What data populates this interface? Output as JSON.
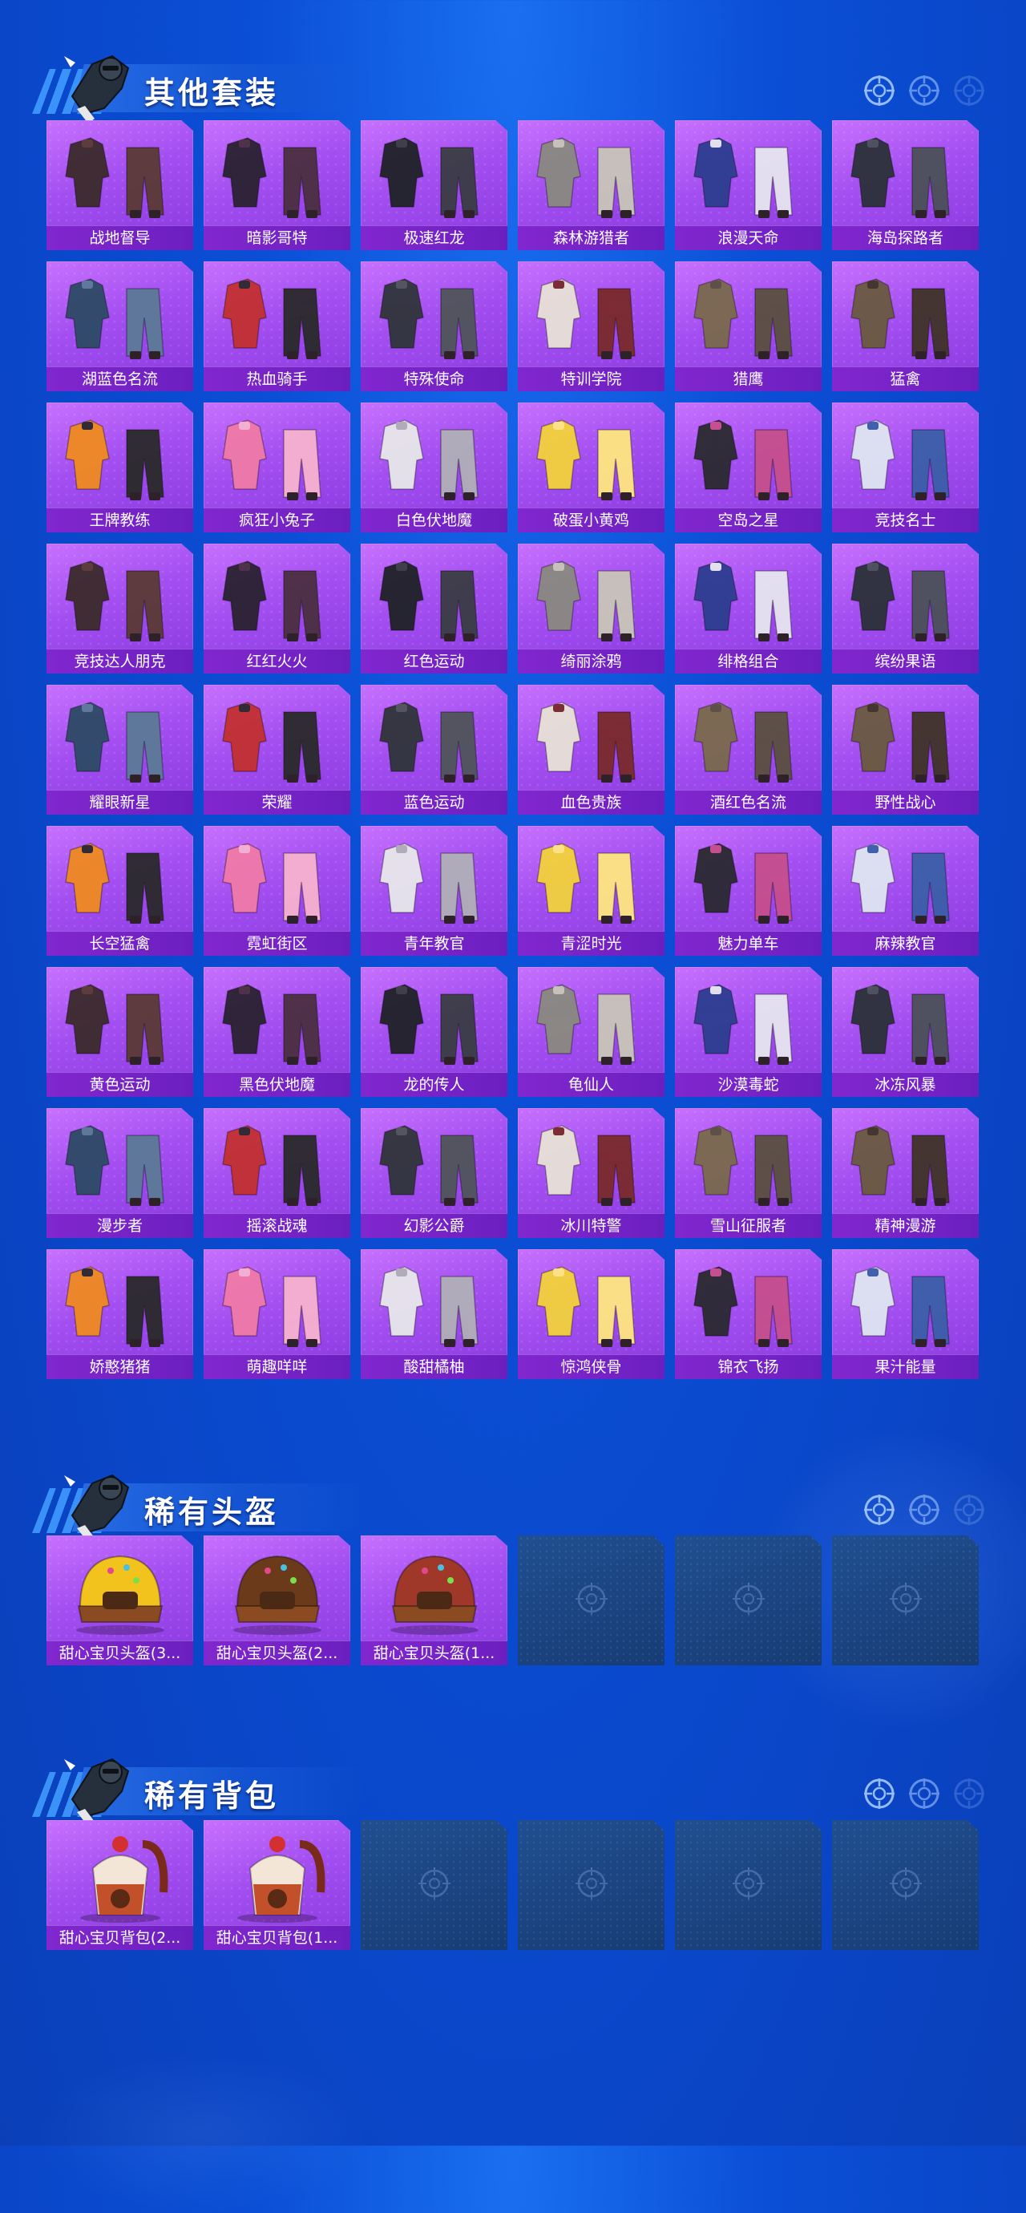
{
  "colors": {
    "page_bg": "#0b4fd6",
    "card_purple": "#a24ef0",
    "label_bar": "#7a23c8",
    "empty_slot": "#1c4584",
    "title_text": "#ffffff"
  },
  "sections": [
    {
      "title": "其他套装",
      "items": [
        {
          "label": "战地督导"
        },
        {
          "label": "暗影哥特"
        },
        {
          "label": "极速红龙"
        },
        {
          "label": "森林游猎者"
        },
        {
          "label": "浪漫天命"
        },
        {
          "label": "海岛探路者"
        },
        {
          "label": "湖蓝色名流"
        },
        {
          "label": "热血骑手"
        },
        {
          "label": "特殊使命"
        },
        {
          "label": "特训学院"
        },
        {
          "label": "猎鹰"
        },
        {
          "label": "猛禽"
        },
        {
          "label": "王牌教练"
        },
        {
          "label": "疯狂小兔子"
        },
        {
          "label": "白色伏地魔"
        },
        {
          "label": "破蛋小黄鸡"
        },
        {
          "label": "空岛之星"
        },
        {
          "label": "竞技名士"
        },
        {
          "label": "竞技达人朋克"
        },
        {
          "label": "红红火火"
        },
        {
          "label": "红色运动"
        },
        {
          "label": "绮丽涂鸦"
        },
        {
          "label": "绯格组合"
        },
        {
          "label": "缤纷果语"
        },
        {
          "label": "耀眼新星"
        },
        {
          "label": "荣耀"
        },
        {
          "label": "蓝色运动"
        },
        {
          "label": "血色贵族"
        },
        {
          "label": "酒红色名流"
        },
        {
          "label": "野性战心"
        },
        {
          "label": "长空猛禽"
        },
        {
          "label": "霓虹街区"
        },
        {
          "label": "青年教官"
        },
        {
          "label": "青涩时光"
        },
        {
          "label": "魅力单车"
        },
        {
          "label": "麻辣教官"
        },
        {
          "label": "黄色运动"
        },
        {
          "label": "黑色伏地魔"
        },
        {
          "label": "龙的传人"
        },
        {
          "label": "龟仙人"
        },
        {
          "label": "沙漠毒蛇"
        },
        {
          "label": "冰冻风暴"
        },
        {
          "label": "漫步者"
        },
        {
          "label": "摇滚战魂"
        },
        {
          "label": "幻影公爵"
        },
        {
          "label": "冰川特警"
        },
        {
          "label": "雪山征服者"
        },
        {
          "label": "精神漫游"
        },
        {
          "label": "娇憨猪猪"
        },
        {
          "label": "萌趣咩咩"
        },
        {
          "label": "酸甜橘柚"
        },
        {
          "label": "惊鸿侠骨"
        },
        {
          "label": "锦衣飞扬"
        },
        {
          "label": "果汁能量"
        }
      ],
      "empty_slots": 0
    },
    {
      "title": "稀有头盔",
      "items": [
        {
          "label": "甜心宝贝头盔(3..."
        },
        {
          "label": "甜心宝贝头盔(2..."
        },
        {
          "label": "甜心宝贝头盔(1..."
        }
      ],
      "empty_slots": 3
    },
    {
      "title": "稀有背包",
      "items": [
        {
          "label": "甜心宝贝背包(2..."
        },
        {
          "label": "甜心宝贝背包(1..."
        }
      ],
      "empty_slots": 4
    }
  ]
}
